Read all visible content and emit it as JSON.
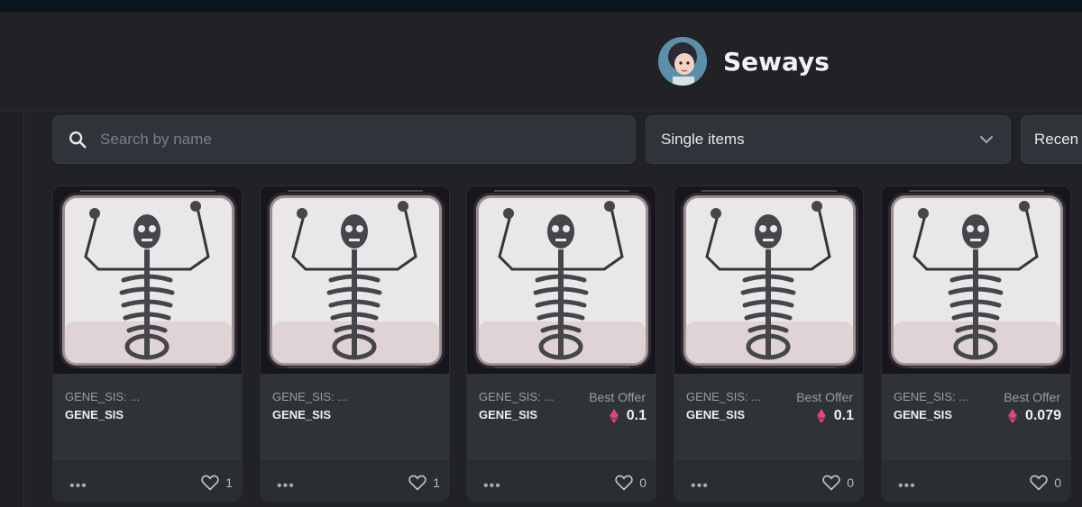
{
  "profile": {
    "name": "Seways",
    "avatar_icon": "user-avatar"
  },
  "search": {
    "placeholder": "Search by name",
    "icon": "search-icon"
  },
  "filter": {
    "selected": "Single items",
    "icon": "chevron-down-icon"
  },
  "sort": {
    "selected": "Recen"
  },
  "colors": {
    "background": "#202225",
    "card": "#2f3237",
    "eth": "#e0457b"
  },
  "cards": [
    {
      "collection": "GENE_SIS: ...",
      "name": "GENE_SIS",
      "offer_label": "",
      "price": "",
      "likes": "1"
    },
    {
      "collection": "GENE_SIS: ...",
      "name": "GENE_SIS",
      "offer_label": "",
      "price": "",
      "likes": "1"
    },
    {
      "collection": "GENE_SIS: ...",
      "name": "GENE_SIS",
      "offer_label": "Best Offer",
      "price": "0.1",
      "likes": "0"
    },
    {
      "collection": "GENE_SIS: ...",
      "name": "GENE_SIS",
      "offer_label": "Best Offer",
      "price": "0.1",
      "likes": "0"
    },
    {
      "collection": "GENE_SIS: ...",
      "name": "GENE_SIS",
      "offer_label": "Best Offer",
      "price": "0.079",
      "likes": "0"
    }
  ],
  "more_icon": "more-dots-icon",
  "more_text": "•••"
}
